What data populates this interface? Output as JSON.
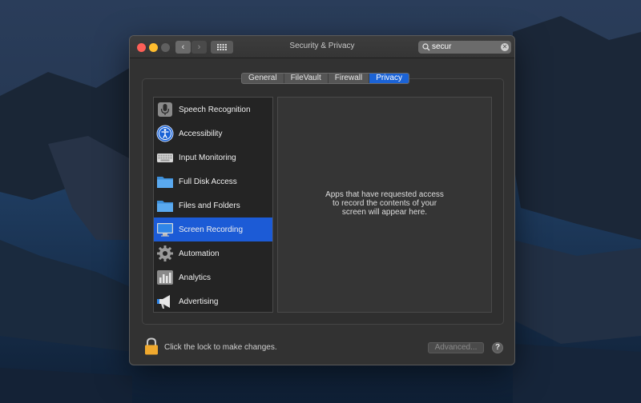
{
  "window": {
    "title": "Security & Privacy",
    "nav_back": "‹",
    "nav_forward": "›"
  },
  "search": {
    "value": "secur",
    "clear": "✕"
  },
  "tabs": [
    {
      "label": "General",
      "active": false
    },
    {
      "label": "FileVault",
      "active": false
    },
    {
      "label": "Firewall",
      "active": false
    },
    {
      "label": "Privacy",
      "active": true
    }
  ],
  "sidebar": {
    "items": [
      {
        "label": "Speech Recognition",
        "icon": "microphone-icon"
      },
      {
        "label": "Accessibility",
        "icon": "accessibility-icon"
      },
      {
        "label": "Input Monitoring",
        "icon": "keyboard-icon"
      },
      {
        "label": "Full Disk Access",
        "icon": "folder-icon"
      },
      {
        "label": "Files and Folders",
        "icon": "folder-icon"
      },
      {
        "label": "Screen Recording",
        "icon": "display-icon",
        "selected": true
      },
      {
        "label": "Automation",
        "icon": "gear-icon"
      },
      {
        "label": "Analytics",
        "icon": "analytics-icon"
      },
      {
        "label": "Advertising",
        "icon": "megaphone-icon"
      }
    ]
  },
  "detail": {
    "message": "Apps that have requested access\nto record the contents of your\nscreen will appear here."
  },
  "footer": {
    "lock_text": "Click the lock to make changes.",
    "advanced_label": "Advanced...",
    "help_label": "?"
  },
  "colors": {
    "accent": "#1c5bd6",
    "window_bg": "#323232"
  }
}
